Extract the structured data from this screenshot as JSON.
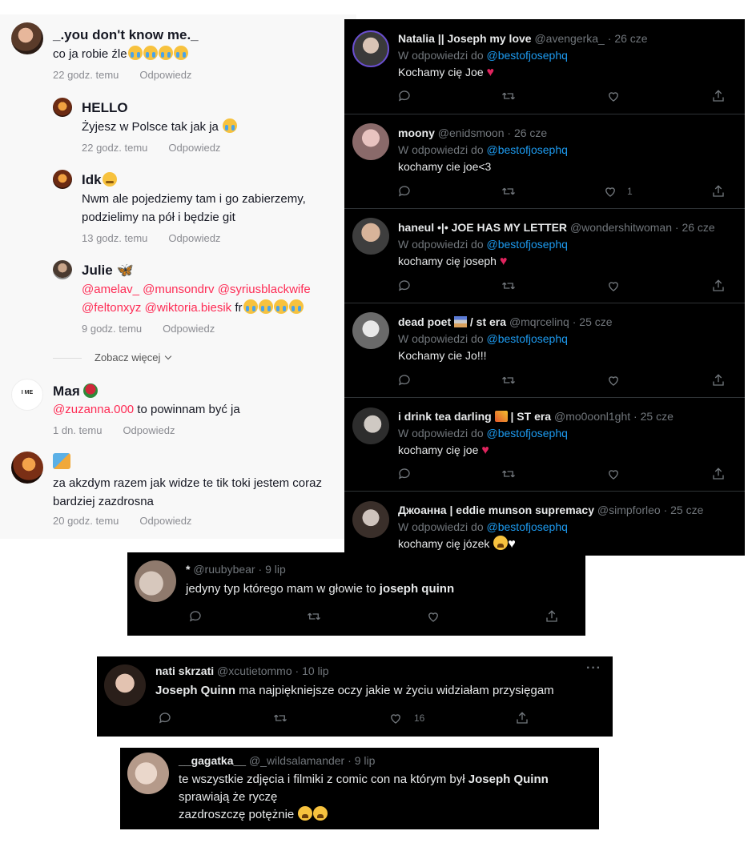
{
  "tiktok": {
    "see_more": "Zobacz więcej",
    "reply_label": "Odpowiedz",
    "comments": [
      {
        "name": "_.you don't know me._",
        "text": "co ja robie źle",
        "time": "22 godz. temu"
      },
      {
        "name": "HELLO",
        "text": "Żyjesz w Polsce tak jak ja",
        "time": "22 godz. temu"
      },
      {
        "name": "Idk",
        "text_line1": "Nwm ale pojedziemy tam i go zabierzemy,",
        "text_line2": "podzielimy na pół i będzie git",
        "time": "13 godz. temu"
      },
      {
        "name": "Julie",
        "mentions_line1": "@amelav_ @munsondrv @syriusblackwife",
        "mentions_line2": "@feltonxyz @wiktoria.biesik",
        "text_tail": " fr",
        "time": "9 godz. temu"
      },
      {
        "name": "Мая",
        "mention": "@zuzanna.000",
        "text": " to powinnam być ja",
        "time": "1 dn. temu",
        "avatar_text": "I ME"
      },
      {
        "name": "",
        "text_line1": "za akzdym razem jak widze te tik toki jestem coraz",
        "text_line2": "bardziej zazdrosna",
        "time": "20 godz. temu"
      }
    ]
  },
  "twitter": {
    "reply_prefix": "W odpowiedzi do",
    "reply_to": "@bestofjosephq",
    "tweets": [
      {
        "name": "Natalia || Joseph my love",
        "handle": "@avengerka_",
        "time": "26 cze",
        "text": "Kochamy cię Joe"
      },
      {
        "name": "moony",
        "handle": "@enidsmoon",
        "time": "26 cze",
        "text": "kochamy cie joe<3",
        "likes": "1"
      },
      {
        "name": "haneul •|• JOE HAS MY LETTER",
        "handle": "@wondershitwoman",
        "time": "26 cze",
        "text": "kochamy cię joseph"
      },
      {
        "name": "dead poet",
        "name_tail": "/ st era",
        "handle": "@mqrcelinq",
        "time": "25 cze",
        "text": "Kochamy cie Jo!!!"
      },
      {
        "name": "i drink tea darling",
        "name_tail": "| ST era",
        "handle": "@mo0oonl1ght",
        "time": "25 cze",
        "text": "kochamy cię joe"
      },
      {
        "name": "Джоанна | eddie munson supremacy",
        "handle": "@simpforleo",
        "time": "25 cze",
        "text": "kochamy cię józek"
      }
    ],
    "cards": [
      {
        "name": "*",
        "handle": "@ruubybear",
        "time": "9 lip",
        "text_pre": "jedyny typ którego mam w głowie to ",
        "text_bold": "joseph quinn"
      },
      {
        "name": "nati skrzati",
        "handle": "@xcutietommo",
        "time": "10 lip",
        "text_bold": "Joseph Quinn",
        "text_post": " ma najpiękniejsze oczy jakie w życiu widziałam przysięgam",
        "likes": "16",
        "more": "···"
      },
      {
        "name": "__gagatka__",
        "handle": "@_wildsalamander",
        "time": "9 lip",
        "line1_pre": "te wszystkie zdjęcia i filmiki z comic con na którym był ",
        "line1_bold": "Joseph Quinn",
        "line2": "sprawiają że ryczę",
        "line3": "zazdroszczę potężnie"
      }
    ]
  },
  "colors": {
    "mention": "#fe2c55",
    "link": "#1d9bf0",
    "dark_bg": "#000000",
    "light_bg": "#f8f8f8"
  }
}
